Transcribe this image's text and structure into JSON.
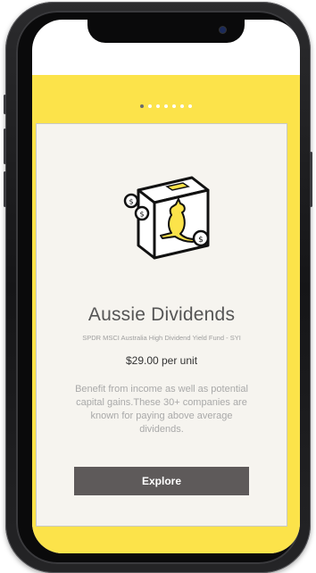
{
  "carousel": {
    "dot_count": 7,
    "active_index": 0
  },
  "card": {
    "title": "Aussie Dividends",
    "subtitle": "SPDR MSCI Australia High Dividend Yield Fund - SYI",
    "price": "$29.00 per unit",
    "description": "Benefit from income as well as potential capital gains.These 30+ companies are known for paying above average dividends.",
    "button_label": "Explore",
    "icon": "kangaroo-box-icon"
  },
  "colors": {
    "accent": "#fce34a",
    "card_background": "#f6f4ef",
    "button": "#5e5a5a"
  }
}
